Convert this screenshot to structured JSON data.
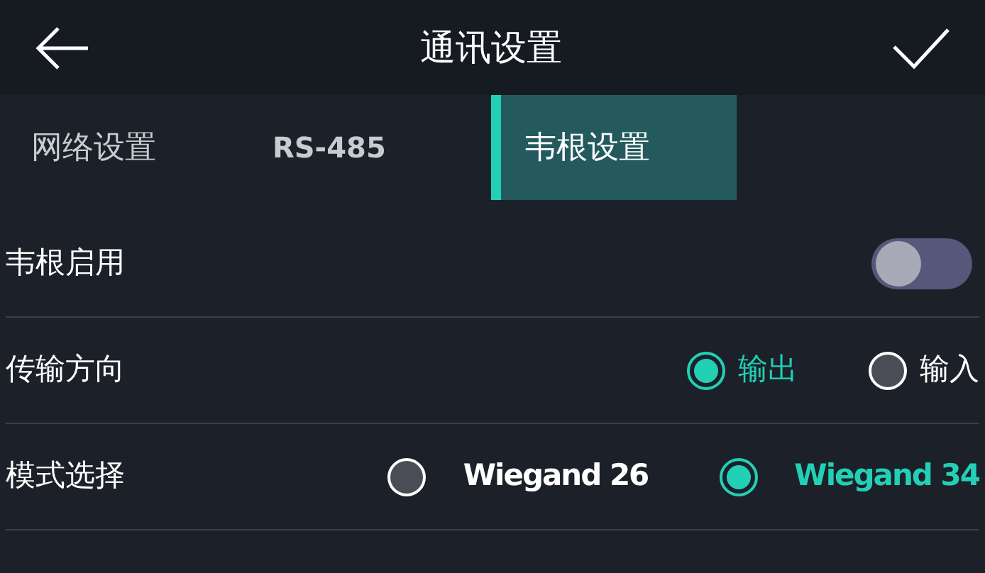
{
  "header": {
    "title": "通讯设置"
  },
  "tabs": [
    {
      "label": "网络设置",
      "selected": false
    },
    {
      "label": "RS-485",
      "selected": false
    },
    {
      "label": "韦根设置",
      "selected": true
    }
  ],
  "rows": [
    {
      "kind": "toggle",
      "label": "韦根启用",
      "on": false
    },
    {
      "kind": "radio",
      "label": "传输方向",
      "options": [
        {
          "label": "输出",
          "selected": true
        },
        {
          "label": "输入",
          "selected": false
        }
      ]
    },
    {
      "kind": "radio",
      "label": "模式选择",
      "options": [
        {
          "label": "Wiegand 26",
          "selected": false
        },
        {
          "label": "Wiegand 34",
          "selected": true
        }
      ]
    }
  ]
}
